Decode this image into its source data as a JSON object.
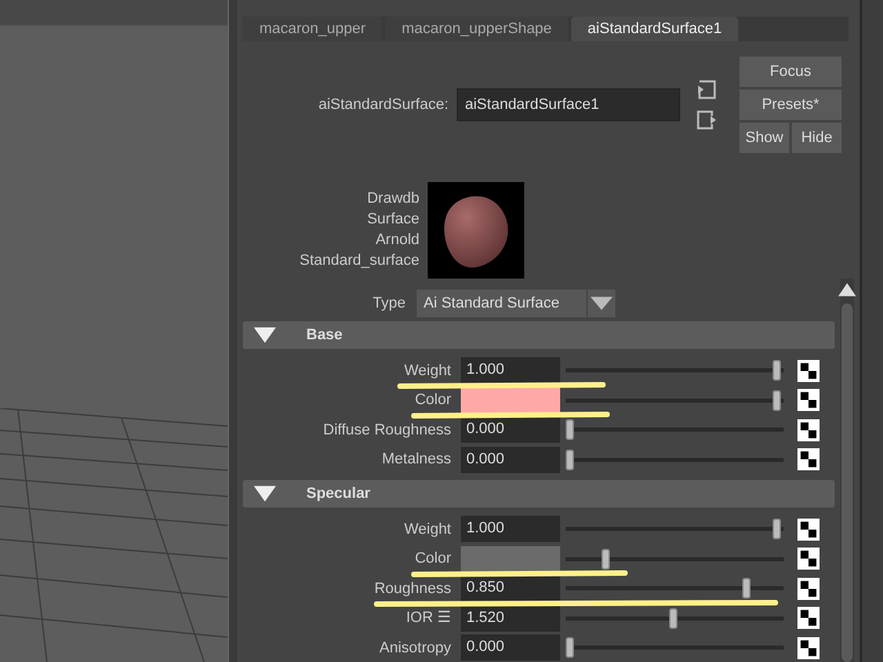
{
  "tabs": [
    {
      "label": "macaron_upper",
      "selected": false
    },
    {
      "label": "macaron_upperShape",
      "selected": false
    },
    {
      "label": "aiStandardSurface1",
      "selected": true
    }
  ],
  "node": {
    "label": "aiStandardSurface:",
    "value": "aiStandardSurface1"
  },
  "buttons": [
    {
      "label": "Focus"
    },
    {
      "label": "Presets*"
    },
    {
      "label": "Show"
    },
    {
      "label": "Hide"
    }
  ],
  "swatch_caption": [
    "Drawdb",
    "Surface",
    "Arnold",
    "Standard_surface"
  ],
  "type": {
    "label": "Type",
    "value": "Ai Standard Surface"
  },
  "sections": [
    {
      "title": "Base",
      "expanded": true,
      "rows": [
        {
          "label": "Weight",
          "kind": "number",
          "value": "1.000",
          "level": 1
        },
        {
          "label": "Color",
          "kind": "color",
          "color": "#ffa8a8",
          "level": 1
        },
        {
          "label": "Diffuse Roughness",
          "kind": "number",
          "value": "0.000",
          "level": 0
        },
        {
          "label": "Metalness",
          "kind": "number",
          "value": "0.000",
          "level": 0
        }
      ]
    },
    {
      "title": "Specular",
      "expanded": true,
      "rows": [
        {
          "label": "Weight",
          "kind": "number",
          "value": "1.000",
          "level": 1
        },
        {
          "label": "Color",
          "kind": "color",
          "color": "#6b6b6b",
          "level": 0.17
        },
        {
          "label": "Roughness",
          "kind": "number",
          "value": "0.850",
          "level": 0.85
        },
        {
          "label": "IOR ☰",
          "kind": "number",
          "value": "1.520",
          "level": 0.5
        },
        {
          "label": "Anisotropy",
          "kind": "number",
          "value": "0.000",
          "level": 0
        }
      ]
    }
  ]
}
